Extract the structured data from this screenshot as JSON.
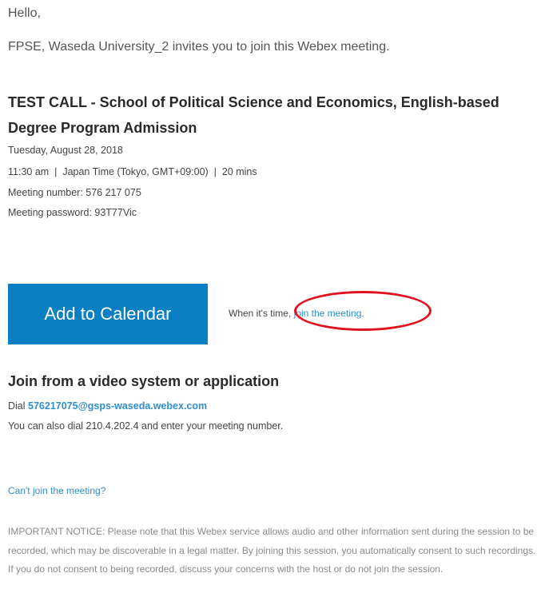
{
  "greeting": "Hello,",
  "invite": "FPSE, Waseda University_2 invites you to join this Webex meeting.",
  "meeting": {
    "title": "TEST CALL - School of Political Science and Economics, English-based Degree Program Admission",
    "date": "Tuesday, August 28, 2018",
    "time": "11:30 am  |  Japan Time (Tokyo, GMT+09:00)  |  20 mins",
    "number": "Meeting number: 576 217 075",
    "password": "Meeting password: 93T77Vic"
  },
  "calendar_button": "Add to Calendar",
  "join_prompt": {
    "prefix": "When it's time, ",
    "link": "join the meeting",
    "suffix": "."
  },
  "video": {
    "heading": "Join from a video system or application",
    "dial_prefix": "Dial ",
    "dial_address": "576217075@gsps-waseda.webex.com",
    "also": "You can also dial 210.4.202.4 and enter your meeting number."
  },
  "cant_join": "Can't join the meeting?",
  "notice": "IMPORTANT NOTICE: Please note that this Webex service allows audio and other information sent during the session to be recorded, which may be discoverable in a legal matter. By joining this session, you automatically consent to such recordings. If you do not consent to being recorded, discuss your concerns with the host or do not join the session.",
  "annotation_color": "#e0121d",
  "accent_color": "#0a7fc3"
}
